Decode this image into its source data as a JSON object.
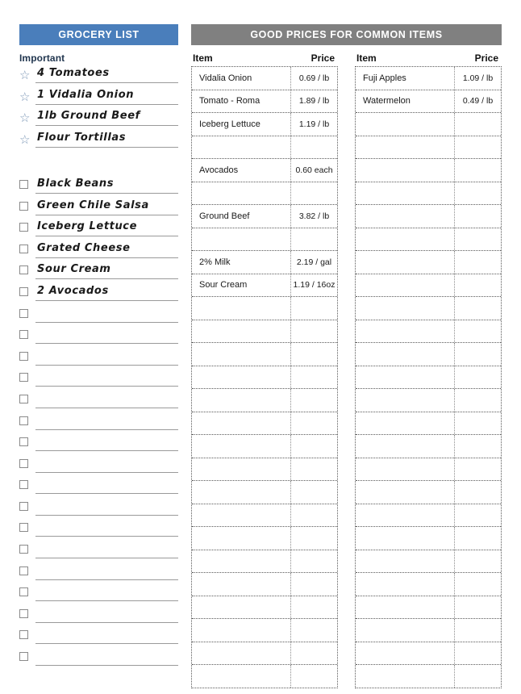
{
  "grocery": {
    "banner_title": "GROCERY LIST",
    "banner_color": "#4a7ebb",
    "section_label": "Important",
    "star_icon": "star-outline",
    "checkbox_icon": "checkbox-empty",
    "starred_items": [
      "4 Tomatoes",
      "1 Vidalia Onion",
      "1lb Ground Beef",
      "Flour Tortillas"
    ],
    "checkbox_items": [
      "Black Beans",
      "Green Chile Salsa",
      "Iceberg Lettuce",
      "Grated Cheese",
      "Sour Cream",
      "2 Avocados",
      "",
      "",
      "",
      "",
      "",
      "",
      "",
      "",
      "",
      "",
      "",
      "",
      "",
      "",
      "",
      "",
      ""
    ]
  },
  "prices": {
    "banner_title": "GOOD PRICES FOR COMMON ITEMS",
    "banner_color": "#808080",
    "columns": [
      "Item",
      "Price"
    ],
    "table_left": [
      {
        "item": "Vidalia Onion",
        "price": "0.69 / lb"
      },
      {
        "item": "Tomato - Roma",
        "price": "1.89 / lb"
      },
      {
        "item": "Iceberg Lettuce",
        "price": "1.19 / lb"
      },
      {
        "item": "",
        "price": ""
      },
      {
        "item": "Avocados",
        "price": "0.60 each"
      },
      {
        "item": "",
        "price": ""
      },
      {
        "item": "Ground Beef",
        "price": "3.82 / lb"
      },
      {
        "item": "",
        "price": ""
      },
      {
        "item": "2% Milk",
        "price": "2.19 / gal"
      },
      {
        "item": "Sour Cream",
        "price": "1.19 / 16oz"
      },
      {
        "item": "",
        "price": ""
      },
      {
        "item": "",
        "price": ""
      },
      {
        "item": "",
        "price": ""
      },
      {
        "item": "",
        "price": ""
      },
      {
        "item": "",
        "price": ""
      },
      {
        "item": "",
        "price": ""
      },
      {
        "item": "",
        "price": ""
      },
      {
        "item": "",
        "price": ""
      },
      {
        "item": "",
        "price": ""
      },
      {
        "item": "",
        "price": ""
      },
      {
        "item": "",
        "price": ""
      },
      {
        "item": "",
        "price": ""
      },
      {
        "item": "",
        "price": ""
      },
      {
        "item": "",
        "price": ""
      },
      {
        "item": "",
        "price": ""
      },
      {
        "item": "",
        "price": ""
      },
      {
        "item": "",
        "price": ""
      }
    ],
    "table_right": [
      {
        "item": "Fuji Apples",
        "price": "1.09 / lb"
      },
      {
        "item": "Watermelon",
        "price": "0.49 / lb"
      },
      {
        "item": "",
        "price": ""
      },
      {
        "item": "",
        "price": ""
      },
      {
        "item": "",
        "price": ""
      },
      {
        "item": "",
        "price": ""
      },
      {
        "item": "",
        "price": ""
      },
      {
        "item": "",
        "price": ""
      },
      {
        "item": "",
        "price": ""
      },
      {
        "item": "",
        "price": ""
      },
      {
        "item": "",
        "price": ""
      },
      {
        "item": "",
        "price": ""
      },
      {
        "item": "",
        "price": ""
      },
      {
        "item": "",
        "price": ""
      },
      {
        "item": "",
        "price": ""
      },
      {
        "item": "",
        "price": ""
      },
      {
        "item": "",
        "price": ""
      },
      {
        "item": "",
        "price": ""
      },
      {
        "item": "",
        "price": ""
      },
      {
        "item": "",
        "price": ""
      },
      {
        "item": "",
        "price": ""
      },
      {
        "item": "",
        "price": ""
      },
      {
        "item": "",
        "price": ""
      },
      {
        "item": "",
        "price": ""
      },
      {
        "item": "",
        "price": ""
      },
      {
        "item": "",
        "price": ""
      },
      {
        "item": "",
        "price": ""
      }
    ]
  }
}
